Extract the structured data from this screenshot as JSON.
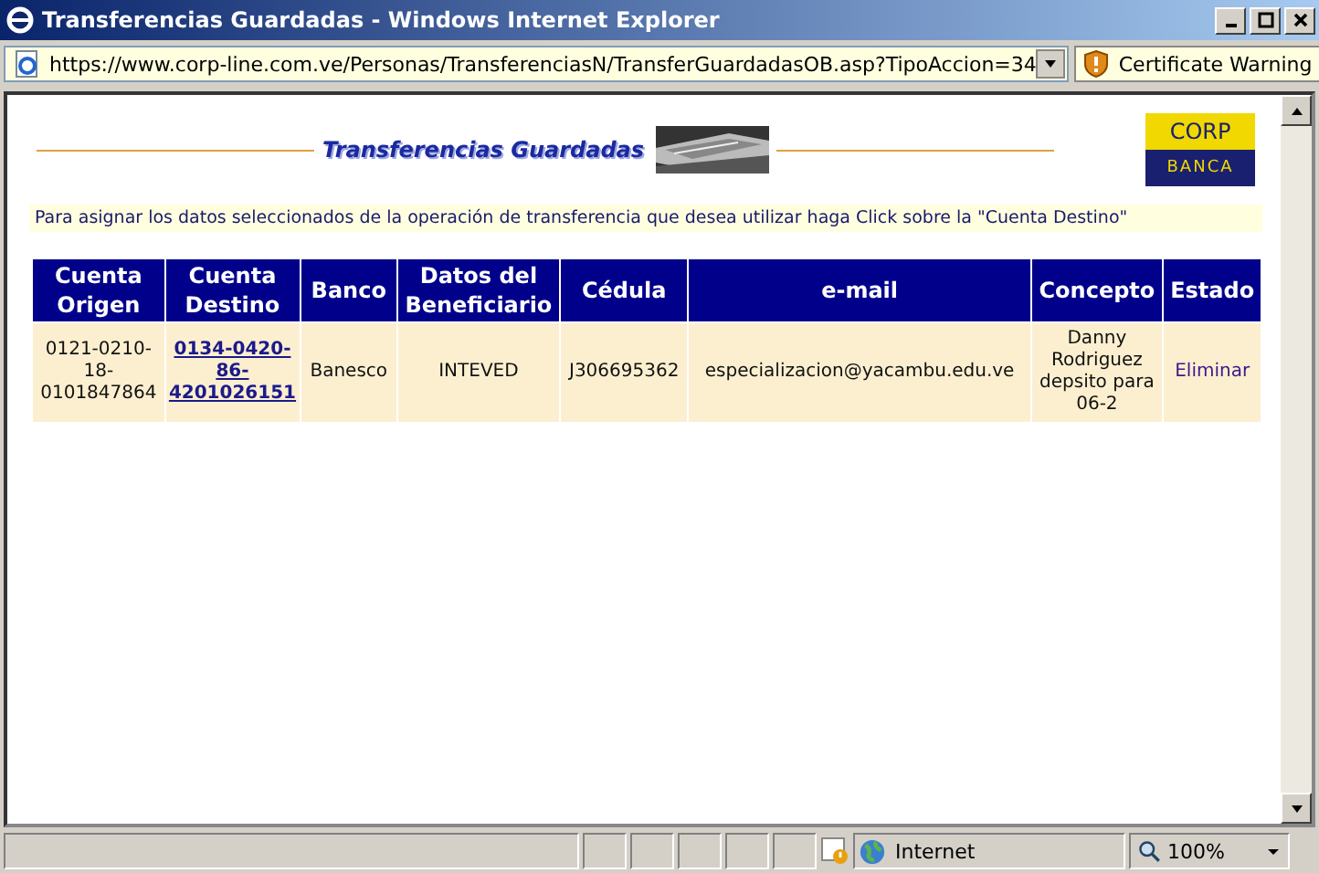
{
  "window": {
    "title": "Transferencias Guardadas - Windows Internet Explorer"
  },
  "address_bar": {
    "url": "https://www.corp-line.com.ve/Personas/TransferenciasN/TransferGuardadasOB.asp?TipoAccion=34",
    "certificate_warning": "Certificate Warning"
  },
  "page": {
    "banner_title": "Transferencias Guardadas",
    "logo": {
      "top": "CORP",
      "bottom": "BANCA"
    },
    "instructions": "Para asignar los datos seleccionados de la operación de transferencia que desea utilizar haga Click sobre la \"Cuenta Destino\"",
    "table": {
      "columns": [
        "Cuenta Origen",
        "Cuenta Destino",
        "Banco",
        "Datos del Beneficiario",
        "Cédula",
        "e-mail",
        "Concepto",
        "Estado"
      ],
      "rows": [
        {
          "cuenta_origen": "0121-0210-18-0101847864",
          "cuenta_destino": "0134-0420-86-4201026151",
          "banco": "Banesco",
          "beneficiario": "INTEVED",
          "cedula": "J306695362",
          "email": "especializacion@yacambu.edu.ve",
          "concepto": "Danny Rodriguez depsito para 06-2",
          "estado": "Eliminar"
        }
      ]
    }
  },
  "status_bar": {
    "zone": "Internet",
    "zoom": "100%"
  }
}
